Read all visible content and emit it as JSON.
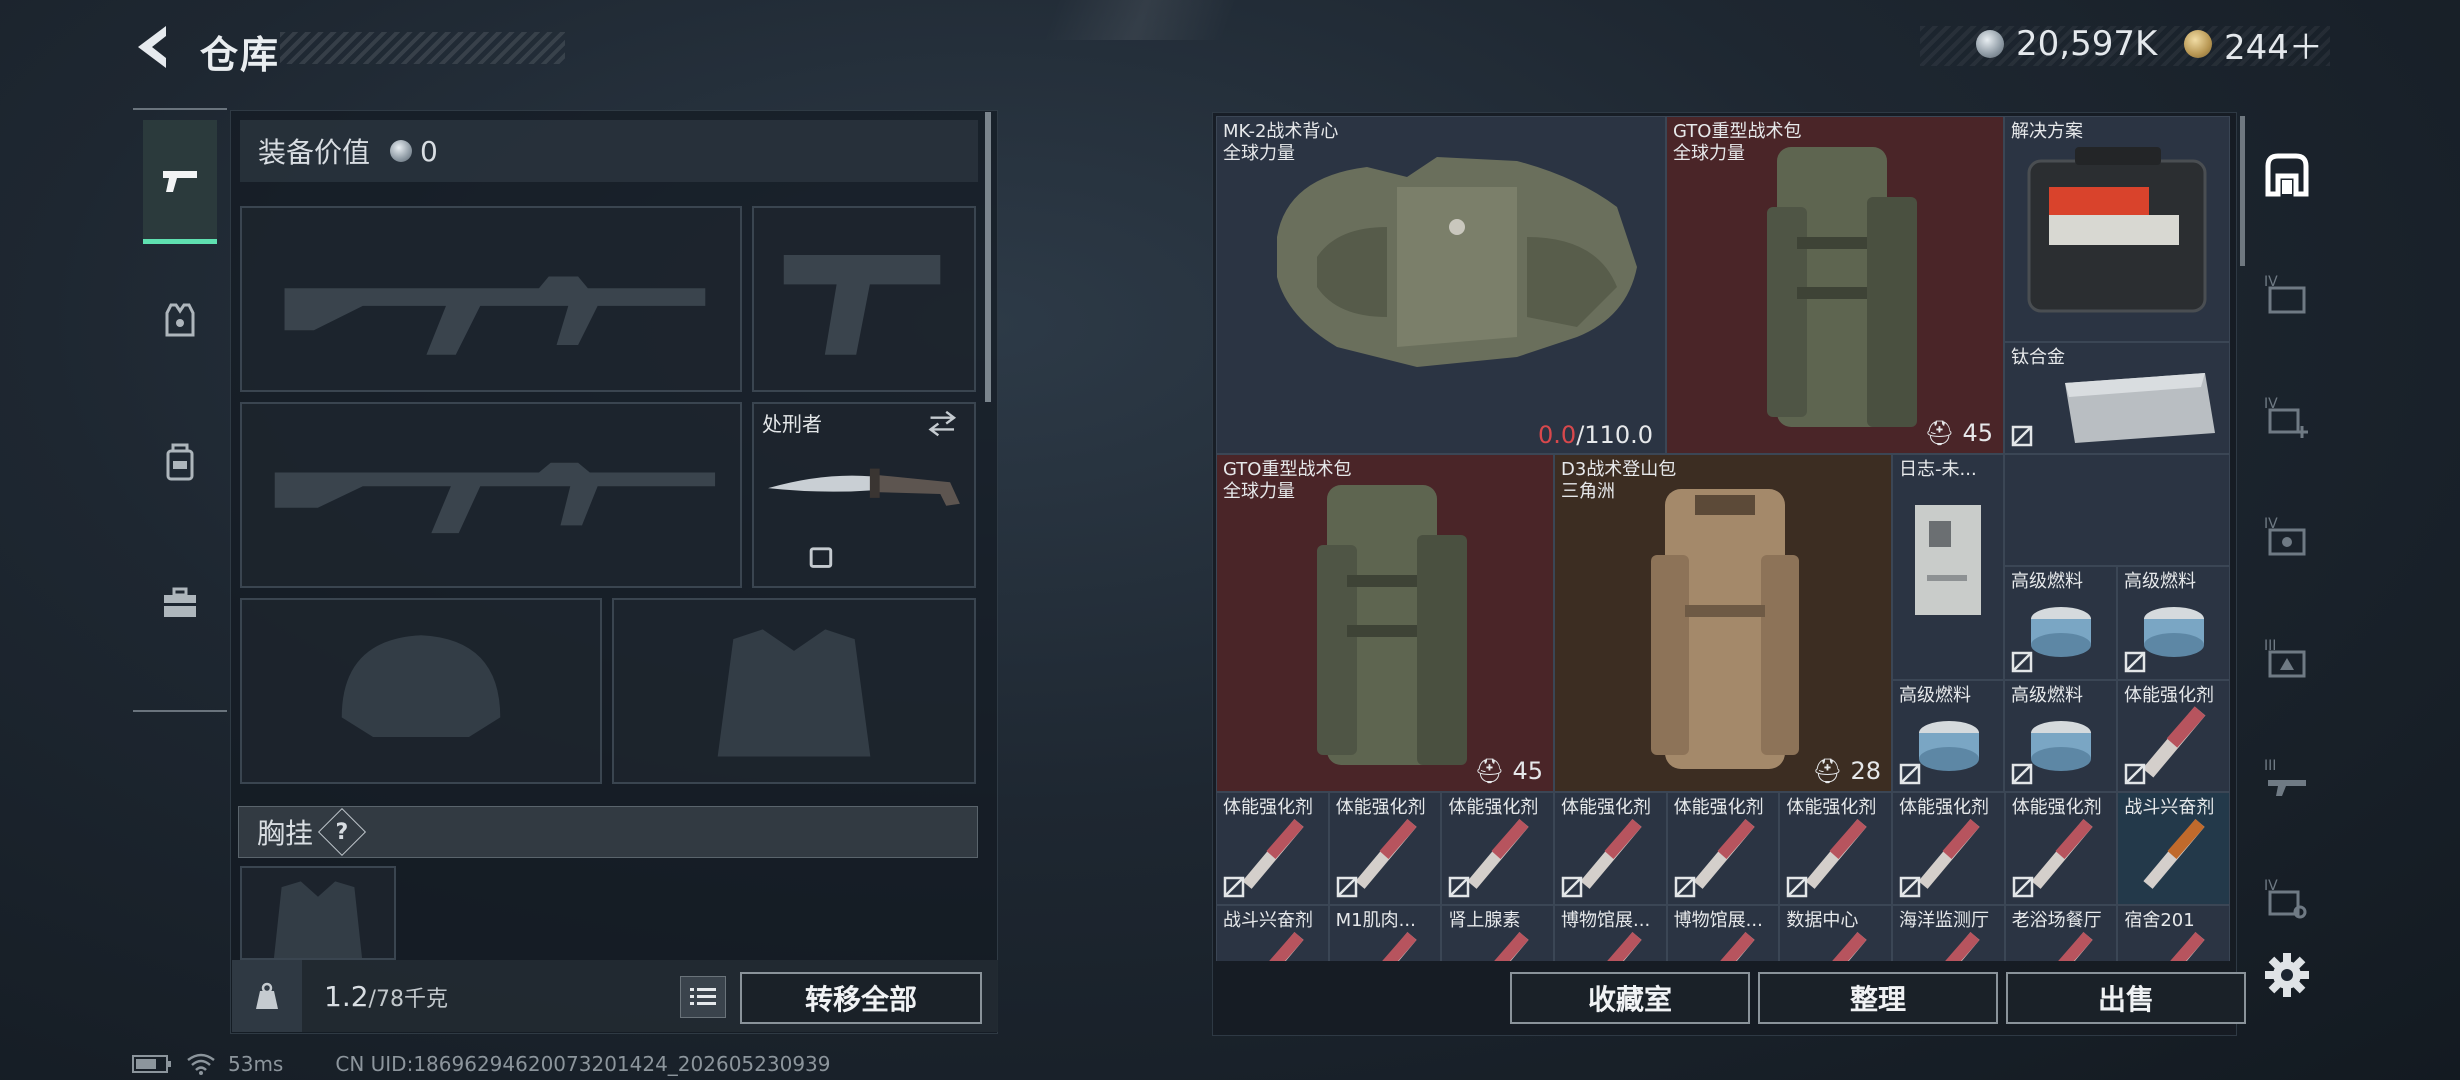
{
  "header": {
    "title": "仓库",
    "currency_silver": "20,597K",
    "currency_gold": "244＋"
  },
  "equipment": {
    "value_label": "装备价值",
    "value": "0",
    "melee_label": "处刑者",
    "chest_label": "胸挂",
    "chest_help": "?",
    "weight_value": "1.2",
    "weight_max": "/78千克",
    "transfer_all": "转移全部"
  },
  "storage": {
    "items": [
      {
        "name": "MK-2战术背心",
        "sub": "全球力量",
        "durability_current": "0.0",
        "durability_max": "/110.0"
      },
      {
        "name": "GTO重型战术包",
        "sub": "全球力量",
        "count": "45"
      },
      {
        "name": "解决方案"
      },
      {
        "name": "钛合金"
      },
      {
        "name": "GTO重型战术包",
        "sub": "全球力量",
        "count": "45"
      },
      {
        "name": "D3战术登山包",
        "sub": "三角洲",
        "count": "28"
      },
      {
        "name": "日志-未..."
      },
      {
        "name": "高级燃料"
      },
      {
        "name": "高级燃料"
      },
      {
        "name": "高级燃料"
      },
      {
        "name": "高级燃料"
      },
      {
        "name": "体能强化剂"
      }
    ],
    "row_stims": [
      "体能强化剂",
      "体能强化剂",
      "体能强化剂",
      "体能强化剂",
      "体能强化剂",
      "体能强化剂",
      "体能强化剂",
      "体能强化剂",
      "战斗兴奋剂"
    ],
    "row_bottom": [
      "战斗兴奋剂",
      "M1肌肉...",
      "肾上腺素",
      "博物馆展...",
      "博物馆展...",
      "数据中心",
      "海洋监测厅",
      "老浴场餐厅",
      "宿舍201"
    ],
    "buttons": {
      "collection": "收藏室",
      "sort": "整理",
      "sell": "出售"
    }
  },
  "status": {
    "ping": "53ms",
    "uid": "CN UID:18696294620073201424_202605230939"
  },
  "colors": {
    "accent_green": "#5fe0b0",
    "durability_red": "#d8484c"
  }
}
